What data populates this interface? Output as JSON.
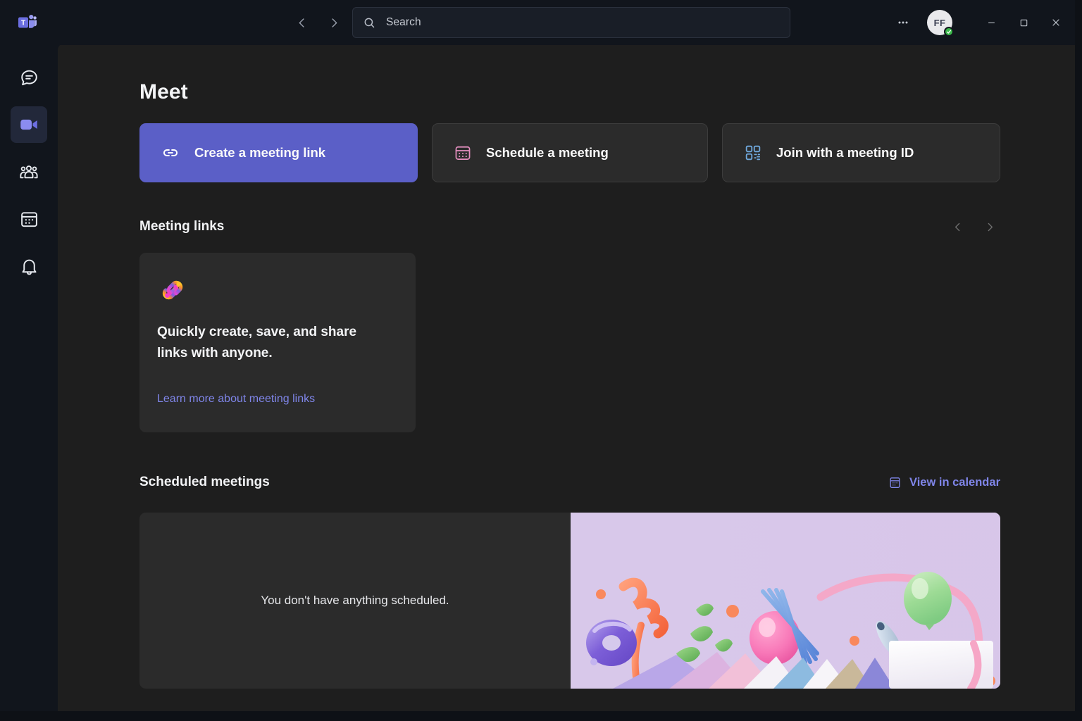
{
  "app": {
    "name": "Microsoft Teams",
    "logo_icon": "teams-logo-icon"
  },
  "titlebar": {
    "back_icon": "chevron-left-icon",
    "forward_icon": "chevron-right-icon",
    "search": {
      "icon": "search-icon",
      "placeholder": "Search",
      "value": "Search"
    },
    "more_label": "•••",
    "more_icon": "ellipsis-icon",
    "avatar": {
      "initials": "FF",
      "presence": "Available",
      "presence_icon": "checkmark-icon",
      "presence_color": "#3ab94a"
    },
    "window_controls": {
      "minimize_icon": "minimize-icon",
      "maximize_icon": "maximize-icon",
      "close_icon": "close-icon"
    }
  },
  "rail": {
    "items": [
      {
        "id": "chat",
        "label": "Chat",
        "icon": "chat-icon",
        "active": false
      },
      {
        "id": "meet",
        "label": "Meet",
        "icon": "video-camera-icon",
        "active": true
      },
      {
        "id": "teams",
        "label": "Teams",
        "icon": "people-icon",
        "active": false
      },
      {
        "id": "calendar",
        "label": "Calendar",
        "icon": "calendar-icon",
        "active": false
      },
      {
        "id": "activity",
        "label": "Activity",
        "icon": "bell-icon",
        "active": false
      }
    ]
  },
  "main": {
    "page_title": "Meet",
    "actions": [
      {
        "label": "Create a meeting link",
        "icon": "link-icon",
        "style": "primary",
        "icon_color": "#ffffff"
      },
      {
        "label": "Schedule a meeting",
        "icon": "calendar-icon",
        "style": "secondary",
        "icon_color": "#e58fc0"
      },
      {
        "label": "Join with a meeting ID",
        "icon": "qr-code-icon",
        "style": "secondary",
        "icon_color": "#6fa8dc"
      }
    ],
    "meeting_links": {
      "section_title": "Meeting links",
      "prev_icon": "chevron-left-icon",
      "next_icon": "chevron-right-icon",
      "card": {
        "art_icon": "gradient-link-icon",
        "headline": "Quickly create, save, and share links with anyone.",
        "learn_more": "Learn more about meeting links"
      }
    },
    "scheduled_meetings": {
      "section_title": "Scheduled meetings",
      "view_in_calendar": {
        "label": "View in calendar",
        "icon": "calendar-icon"
      },
      "empty_state": "You don't have anything scheduled.",
      "illustration": "party-celebration-3d-illustration"
    }
  },
  "colors": {
    "brand_purple": "#5b5fc7",
    "link_purple": "#7f85e8",
    "content_bg": "#1e1e1e",
    "card_bg": "#2b2b2b",
    "rail_bg": "#11151c",
    "illustration_bg": "#d5c9ec"
  }
}
